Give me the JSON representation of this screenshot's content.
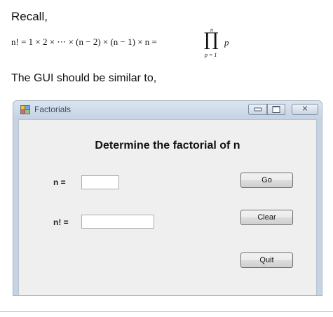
{
  "document": {
    "recall_text": "Recall,",
    "formula": {
      "lhs": "n! = 1 × 2 × ⋯ × (n − 2) × (n − 1) × n =",
      "product_symbol": "∏",
      "upper_limit": "n",
      "lower_limit": "p = 1",
      "term": "p"
    },
    "gui_intro": "The GUI should be similar to,"
  },
  "window": {
    "title": "Factorials",
    "icon": "app-window-icon",
    "controls": {
      "minimize": "minimize-icon",
      "maximize": "maximize-icon",
      "close": "close-icon",
      "close_glyph": "✕"
    }
  },
  "form": {
    "heading": "Determine the factorial of n",
    "n_label": "n =",
    "n_value": "",
    "result_label": "n! =",
    "result_value": "",
    "buttons": {
      "go": "Go",
      "clear": "Clear",
      "quit": "Quit"
    }
  }
}
